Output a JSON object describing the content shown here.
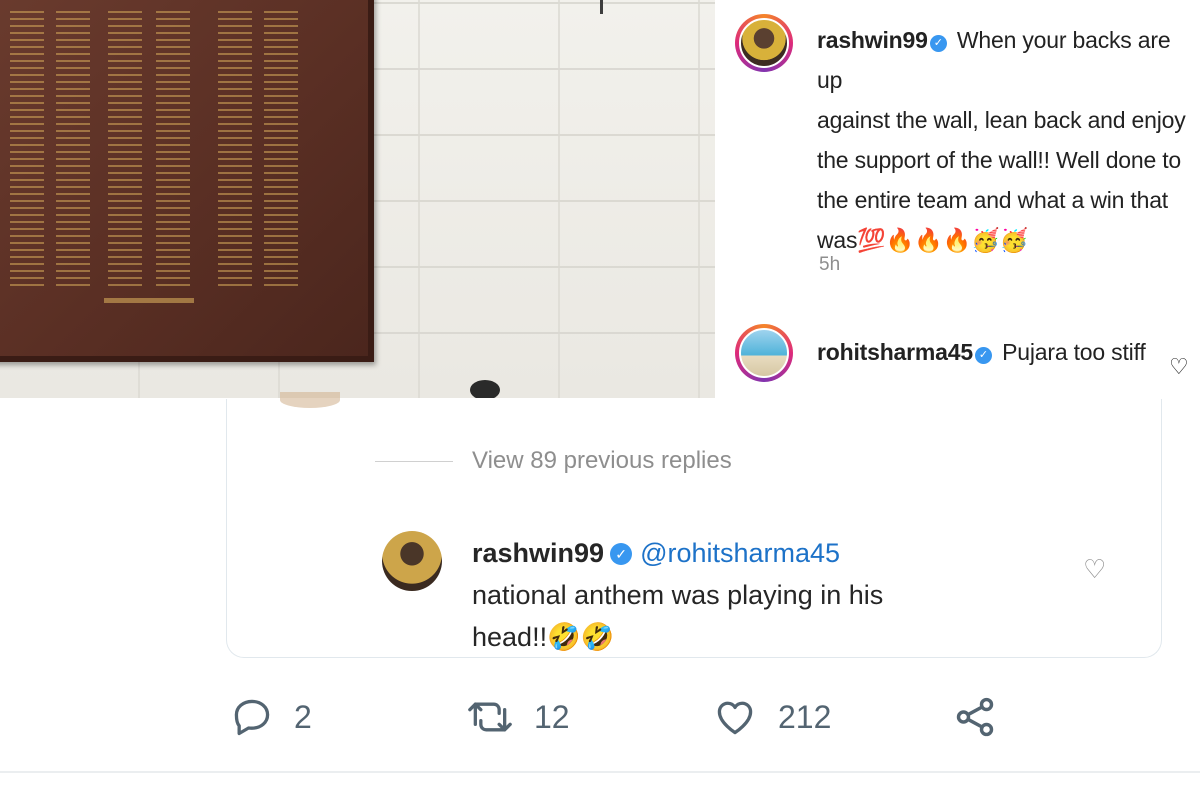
{
  "instagram": {
    "post": {
      "username": "rashwin99",
      "caption_lines": [
        "When your backs are up",
        "against the wall, lean back and enjoy",
        "the support of the wall!! Well done to",
        "the entire team and what a win that",
        "was💯🔥🔥🔥🥳🥳"
      ],
      "time": "5h"
    },
    "comment": {
      "username": "rohitsharma45",
      "text": "Pujara too stiff"
    }
  },
  "twitter": {
    "view_replies": "View 89 previous replies",
    "reply": {
      "username": "rashwin99",
      "mention": "@rohitsharma45",
      "text_line1": "national anthem was playing in his",
      "text_line2": "head!!🤣🤣"
    },
    "actions": {
      "reply_count": "2",
      "retweet_count": "12",
      "like_count": "212"
    }
  },
  "icons": {
    "verified": "verified-badge-icon",
    "heart": "heart-icon",
    "reply": "reply-icon",
    "retweet": "retweet-icon",
    "like": "like-icon",
    "share": "share-icon"
  },
  "colors": {
    "verified_blue": "#3897f0",
    "mention_blue": "#1d72c8",
    "muted_gray": "#8e8e8e",
    "action_gray": "#536471"
  }
}
